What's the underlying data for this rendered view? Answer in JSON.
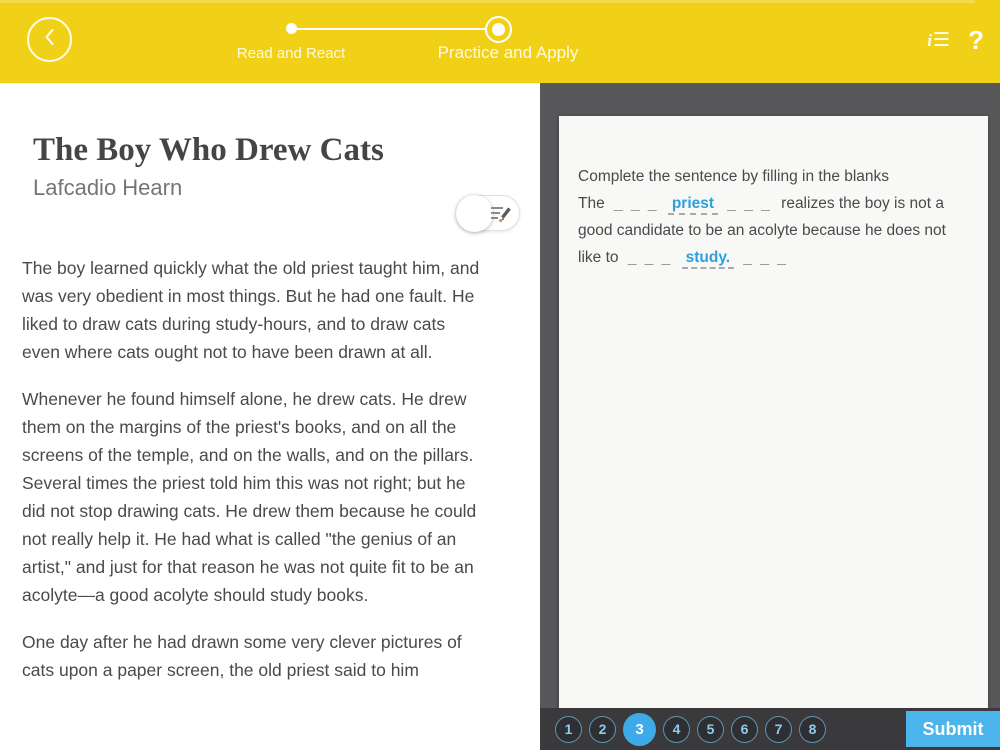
{
  "header": {
    "steps": [
      {
        "label": "Read and React",
        "state": "done"
      },
      {
        "label": "Practice and Apply",
        "state": "active"
      }
    ],
    "help_label": "?",
    "toc_icon_i": "i",
    "toc_icon_lines": "☰"
  },
  "reader": {
    "title": "The Boy Who Drew Cats",
    "author": "Lafcadio Hearn",
    "paragraphs": [
      "The boy learned quickly what the old priest taught him, and was very obedient in most things. But he had one fault. He liked to draw cats during study-hours, and to draw cats even where cats ought not to have been drawn at all.",
      "Whenever he found himself alone, he drew cats. He drew them on the margins of the priest's books, and on all the screens of the temple, and on the walls, and on the pillars. Several times the priest told him this was not right; but he did not stop drawing cats. He drew them because he could not really help it. He had what is called \"the genius of an artist,\" and just for that reason he was not quite fit to be an acolyte—a good acolyte should study books.",
      "One day after he had drawn some very clever pictures of cats upon a paper screen, the old priest said to him"
    ]
  },
  "activity": {
    "prompt": "Complete the sentence by filling in the blanks",
    "sentence": {
      "lead": "The",
      "blank1": "_ _ _",
      "answer1": "priest",
      "blank2": "_ _ _",
      "middle": "realizes the boy is not a good candidate to be an acolyte because he does not like to",
      "blank3": "_ _ _",
      "answer2": "study.",
      "blank4": "_ _ _"
    },
    "pager": {
      "items": [
        "1",
        "2",
        "3",
        "4",
        "5",
        "6",
        "7",
        "8"
      ],
      "active": "3"
    },
    "submit_label": "Submit"
  },
  "colors": {
    "header_yellow": "#F1D117",
    "panel_gray": "#58585A",
    "dock_gray": "#3A3A3C",
    "accent_blue": "#3FAAE8",
    "submit_blue": "#4BB4EA",
    "answer_blue": "#2D9FDE",
    "card_bg": "#F8F8F6"
  }
}
